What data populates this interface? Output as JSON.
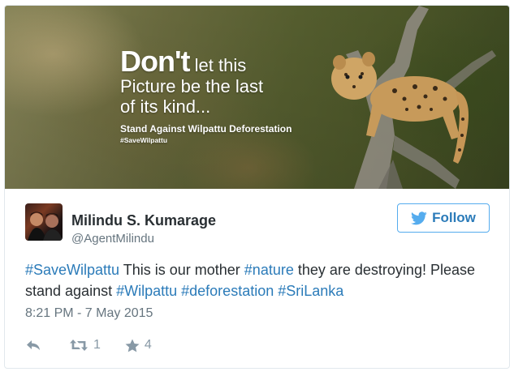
{
  "banner": {
    "line1_big": "Don't",
    "line1_rest": "let this",
    "line2": "Picture be the last",
    "line3": "of its kind...",
    "stand": "Stand Against Wilpattu Deforestation",
    "tag": "#SaveWilpattu"
  },
  "user": {
    "display_name": "Milindu S. Kumarage",
    "handle": "@AgentMilindu"
  },
  "follow": {
    "label": "Follow"
  },
  "tweet": {
    "seg1": "#SaveWilpattu",
    "seg2": " This is our mother ",
    "seg3": "#nature",
    "seg4": " they are destroying! Please stand against ",
    "seg5": "#Wilpattu",
    "seg6": " ",
    "seg7": "#deforestation",
    "seg8": " ",
    "seg9": "#SriLanka"
  },
  "timestamp": "8:21 PM - 7 May 2015",
  "actions": {
    "reply_icon": "reply-icon",
    "retweet_icon": "retweet-icon",
    "retweet_count": "1",
    "favorite_icon": "star-icon",
    "favorite_count": "4"
  },
  "colors": {
    "link": "#2b7bb9",
    "follow_border": "#55acee",
    "text": "#292f33",
    "muted": "#66757f",
    "action_gray": "#8899a6"
  }
}
